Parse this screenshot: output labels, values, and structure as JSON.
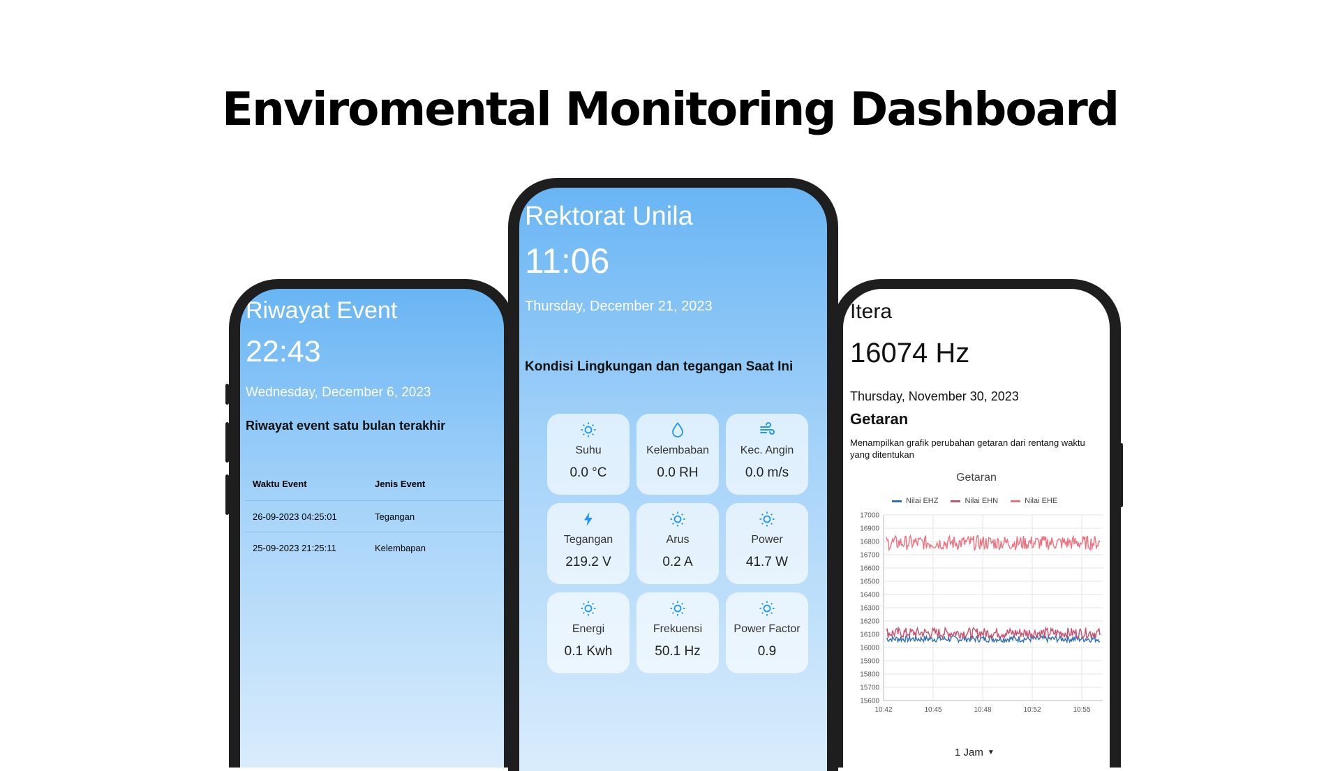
{
  "page": {
    "headline": "Enviromental Monitoring Dashboard"
  },
  "left": {
    "title": "Riwayat Event",
    "time": "22:43",
    "date": "Wednesday, December 6, 2023",
    "subtitle": "Riwayat event satu bulan terakhir",
    "table": {
      "headers": [
        "Waktu Event",
        "Jenis Event"
      ],
      "rows": [
        [
          "26-09-2023 04:25:01",
          "Tegangan"
        ],
        [
          "25-09-2023 21:25:11",
          "Kelembapan"
        ]
      ]
    }
  },
  "center": {
    "title": "Rektorat Unila",
    "time": "11:06",
    "date": "Thursday, December 21, 2023",
    "subtitle": "Kondisi Lingkungan dan tegangan Saat Ini",
    "tiles": [
      {
        "icon": "sun-icon",
        "label": "Suhu",
        "value": "0.0 °C"
      },
      {
        "icon": "droplet-icon",
        "label": "Kelembaban",
        "value": "0.0 RH"
      },
      {
        "icon": "wind-icon",
        "label": "Kec. Angin",
        "value": "0.0 m/s"
      },
      {
        "icon": "bolt-icon",
        "label": "Tegangan",
        "value": "219.2 V"
      },
      {
        "icon": "sun-icon",
        "label": "Arus",
        "value": "0.2 A"
      },
      {
        "icon": "sun-icon",
        "label": "Power",
        "value": "41.7 W"
      },
      {
        "icon": "sun-icon",
        "label": "Energi",
        "value": "0.1 Kwh"
      },
      {
        "icon": "sun-icon",
        "label": "Frekuensi",
        "value": "50.1 Hz"
      },
      {
        "icon": "sun-icon",
        "label": "Power Factor",
        "value": "0.9"
      }
    ],
    "accent": "#2196f3"
  },
  "right": {
    "title": "Itera",
    "value": "16074 Hz",
    "date": "Thursday, November 30, 2023",
    "section": "Getaran",
    "description": "Menampilkan grafik perubahan getaran dari rentang waktu yang ditentukan",
    "range_select": "1 Jam",
    "chart_data": {
      "type": "line",
      "title": "Getaran",
      "x_ticks": [
        "10:42",
        "10:45",
        "10:48",
        "10:52",
        "10:55"
      ],
      "ylim": [
        15600,
        17000
      ],
      "y_ticks": [
        17000,
        16900,
        16800,
        16700,
        16600,
        16500,
        16400,
        16300,
        16200,
        16100,
        16000,
        15900,
        15800,
        15700,
        15600
      ],
      "grid": true,
      "legend_position": "top",
      "series": [
        {
          "name": "Nilai EHZ",
          "color": "#2e6fb7",
          "mean": 16065,
          "spread": 25
        },
        {
          "name": "Nilai EHN",
          "color": "#c9506e",
          "mean": 16110,
          "spread": 40
        },
        {
          "name": "Nilai EHE",
          "color": "#f0707e",
          "mean": 16790,
          "spread": 55
        }
      ]
    }
  }
}
